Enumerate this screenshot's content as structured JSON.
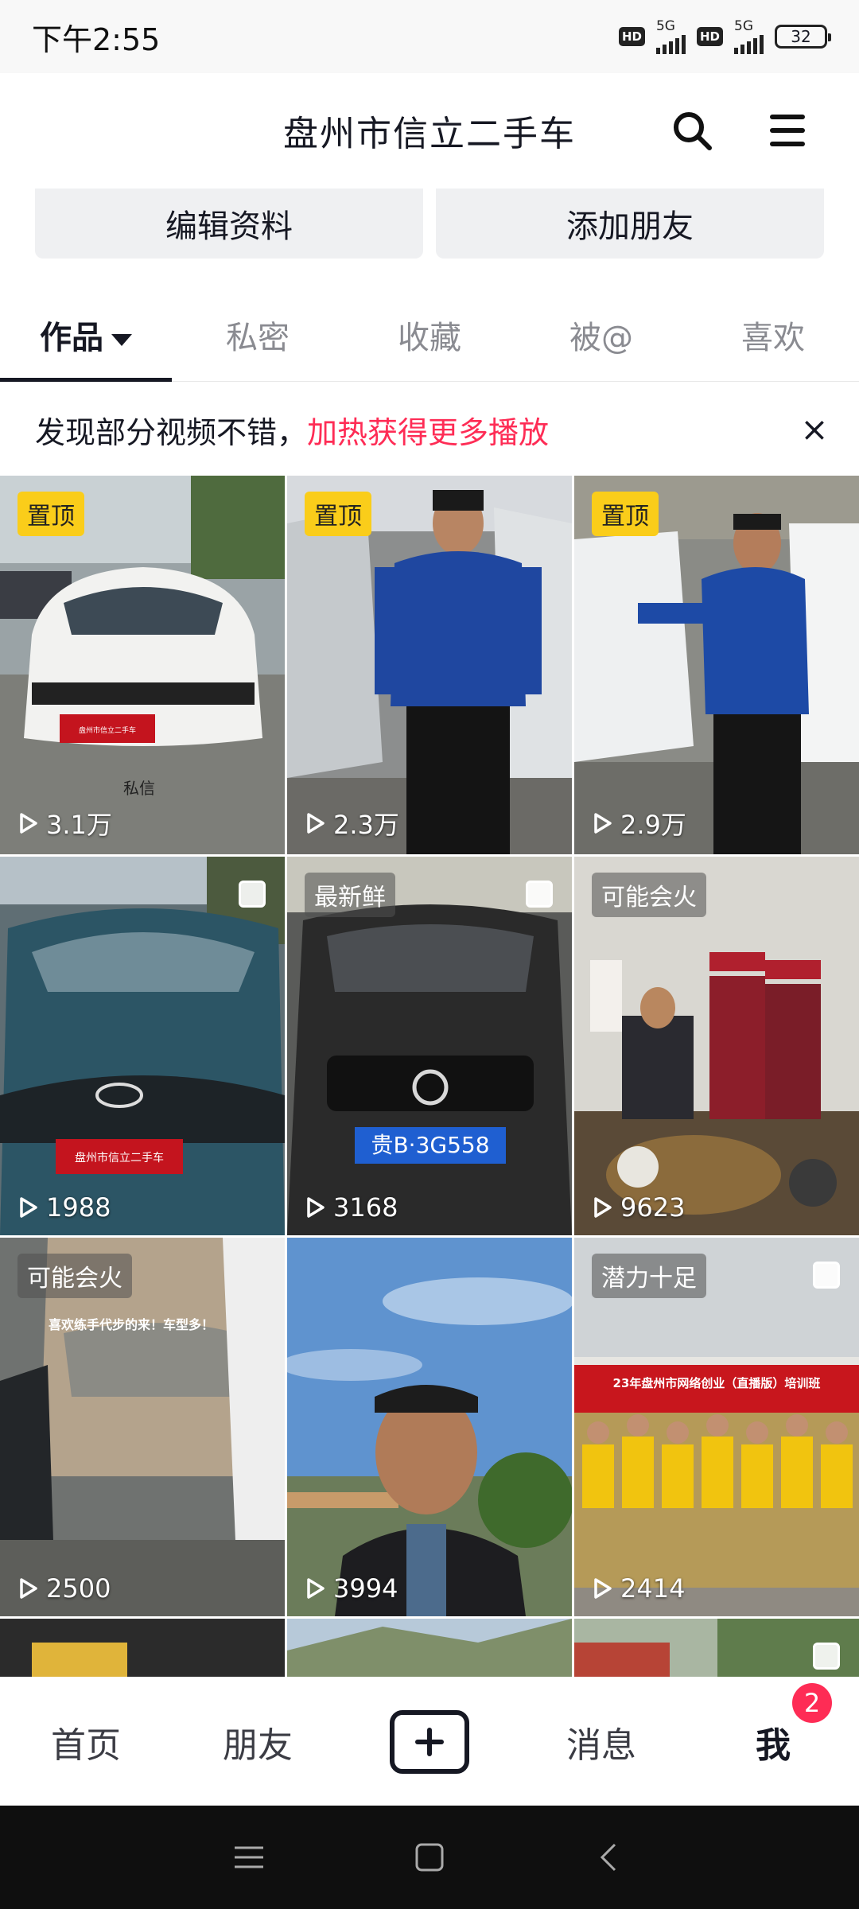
{
  "status_bar": {
    "time": "下午2:55",
    "net1": "5G",
    "net2": "5G",
    "hd": "HD",
    "battery": "32"
  },
  "header": {
    "title": "盘州市信立二手车"
  },
  "profile_actions": {
    "edit": "编辑资料",
    "add_friend": "添加朋友"
  },
  "tabs": [
    {
      "label": "作品"
    },
    {
      "label": "私密"
    },
    {
      "label": "收藏"
    },
    {
      "label": "被@"
    },
    {
      "label": "喜欢"
    }
  ],
  "banner": {
    "text": "发现部分视频不错，",
    "highlight": "加热获得更多播放",
    "close": "×"
  },
  "videos": [
    {
      "badge": "置顶",
      "plays": "3.1万",
      "caption": "私信"
    },
    {
      "badge": "置顶",
      "plays": "2.3万"
    },
    {
      "badge": "置顶",
      "plays": "2.9万"
    },
    {
      "badge": "",
      "plays": "1988",
      "plate": "盘州市信立二手车"
    },
    {
      "badge": "最新鲜",
      "plays": "3168",
      "plate": "贵B·3G558"
    },
    {
      "badge": "可能会火",
      "plays": "9623"
    },
    {
      "badge": "可能会火",
      "plays": "2500",
      "caption": "喜欢练手代步的来！车型多！"
    },
    {
      "badge": "",
      "plays": "3994"
    },
    {
      "badge": "潜力十足",
      "plays": "2414",
      "caption": "23年盘州市网络创业（直播版）培训班"
    }
  ],
  "bottom_nav": {
    "home": "首页",
    "friends": "朋友",
    "messages": "消息",
    "me": "我",
    "me_badge": "2"
  },
  "colors": {
    "accent": "#fe2c55",
    "pinned": "#facd1a"
  }
}
